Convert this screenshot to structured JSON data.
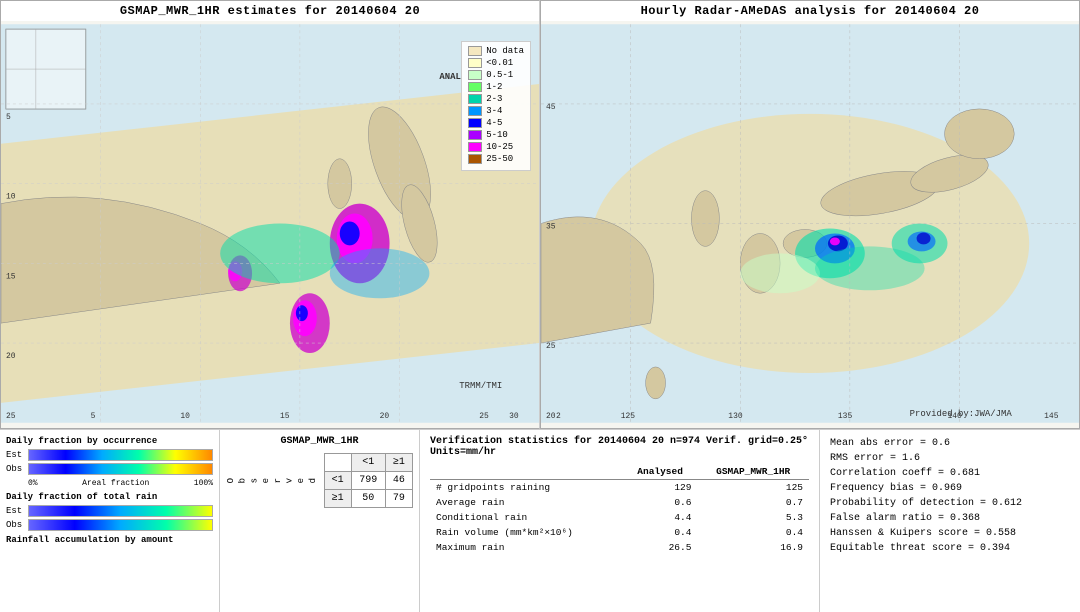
{
  "leftMap": {
    "title": "GSMAP_MWR_1HR estimates for 20140604 20",
    "anal_label": "ANAL",
    "trmm_label": "TRMM/TMI"
  },
  "rightMap": {
    "title": "Hourly Radar-AMeDAS analysis for 20140604 20",
    "jwa_label": "Provided by:JWA/JMA"
  },
  "legend": {
    "title": "",
    "items": [
      {
        "label": "No data",
        "color": "#f5e8c0"
      },
      {
        "label": "<0.01",
        "color": "#ffffc8"
      },
      {
        "label": "0.5-1",
        "color": "#c8ffc8"
      },
      {
        "label": "1-2",
        "color": "#64ff64"
      },
      {
        "label": "2-3",
        "color": "#00d4aa"
      },
      {
        "label": "3-4",
        "color": "#0096ff"
      },
      {
        "label": "4-5",
        "color": "#0000ff"
      },
      {
        "label": "5-10",
        "color": "#aa00ff"
      },
      {
        "label": "10-25",
        "color": "#ff00ff"
      },
      {
        "label": "25-50",
        "color": "#aa5500"
      }
    ]
  },
  "charts": {
    "title1": "Daily fraction by occurrence",
    "est_label": "Est",
    "obs_label": "Obs",
    "zero_pct": "0%",
    "areal_fraction": "Areal fraction",
    "hundred_pct": "100%",
    "title2": "Daily fraction of total rain",
    "title3": "Rainfall accumulation by amount"
  },
  "contingency": {
    "title": "GSMAP_MWR_1HR",
    "col_lt1": "<1",
    "col_ge1": "≥1",
    "row_lt1": "<1",
    "row_ge1": "≥1",
    "v_799": "799",
    "v_46": "46",
    "v_50": "50",
    "v_79": "79",
    "observed": "O\nb\ns\ne\nr\nv\ne\nd"
  },
  "verif": {
    "title": "Verification statistics for 20140604 20  n=974  Verif. grid=0.25°  Units=mm/hr",
    "col_blank": "",
    "col_analysed": "Analysed",
    "col_gsmap": "GSMAP_MWR_1HR",
    "rows": [
      {
        "label": "# gridpoints raining",
        "analysed": "129",
        "gsmap": "125"
      },
      {
        "label": "Average rain",
        "analysed": "0.6",
        "gsmap": "0.7"
      },
      {
        "label": "Conditional rain",
        "analysed": "4.4",
        "gsmap": "5.3"
      },
      {
        "label": "Rain volume (mm*km²×10⁶)",
        "analysed": "0.4",
        "gsmap": "0.4"
      },
      {
        "label": "Maximum rain",
        "analysed": "26.5",
        "gsmap": "16.9"
      }
    ]
  },
  "metrics": {
    "lines": [
      "Mean abs error = 0.6",
      "RMS error = 1.6",
      "Correlation coeff = 0.681",
      "Frequency bias = 0.969",
      "Probability of detection = 0.612",
      "False alarm ratio = 0.368",
      "Hanssen & Kuipers score = 0.558",
      "Equitable threat score = 0.394"
    ]
  }
}
